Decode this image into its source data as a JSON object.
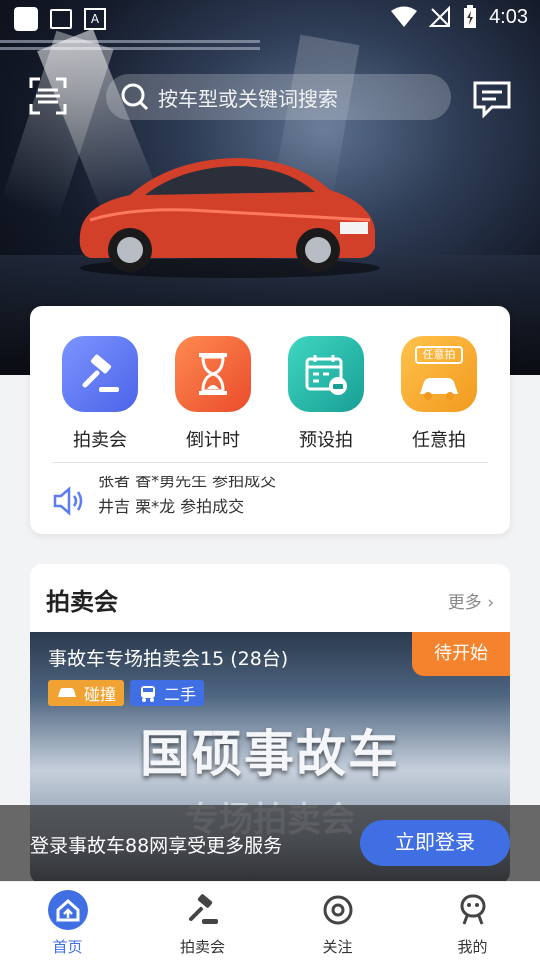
{
  "status_bar": {
    "time": "4:03"
  },
  "search": {
    "placeholder": "按车型或关键词搜索"
  },
  "quick_menu": {
    "items": [
      {
        "label": "拍卖会",
        "icon": "gavel-icon",
        "color": "#5b7cf2"
      },
      {
        "label": "倒计时",
        "icon": "hourglass-icon",
        "color": "#f4663a"
      },
      {
        "label": "预设拍",
        "icon": "calendar-car-icon",
        "color": "#22b8a8"
      },
      {
        "label": "任意拍",
        "icon": "any-bid-car-icon",
        "color": "#f7a92c",
        "badge": "任意拍"
      }
    ],
    "notices": [
      "张者 香*勇先生 参拍成交",
      "井吉 栗*龙 参拍成交"
    ]
  },
  "auction_section": {
    "title": "拍卖会",
    "more": "更多",
    "card": {
      "title": "事故车专场拍卖会15 (28台)",
      "status": "待开始",
      "tags": [
        {
          "label": "碰撞",
          "icon": "car-crash-icon",
          "color": "#f0a232"
        },
        {
          "label": "二手",
          "icon": "car-icon",
          "color": "#3f6fe3"
        }
      ],
      "banner_title": "国硕事故车",
      "banner_sub": "专场拍卖会"
    }
  },
  "login_prompt": {
    "text": "登录事故车88网享受更多服务",
    "button": "立即登录",
    "accent": "#3f6fe3"
  },
  "tabbar": {
    "tabs": [
      {
        "label": "首页",
        "icon": "home-icon",
        "active": true
      },
      {
        "label": "拍卖会",
        "icon": "gavel-icon",
        "active": false
      },
      {
        "label": "关注",
        "icon": "watch-icon",
        "active": false
      },
      {
        "label": "我的",
        "icon": "profile-icon",
        "active": false
      }
    ]
  }
}
